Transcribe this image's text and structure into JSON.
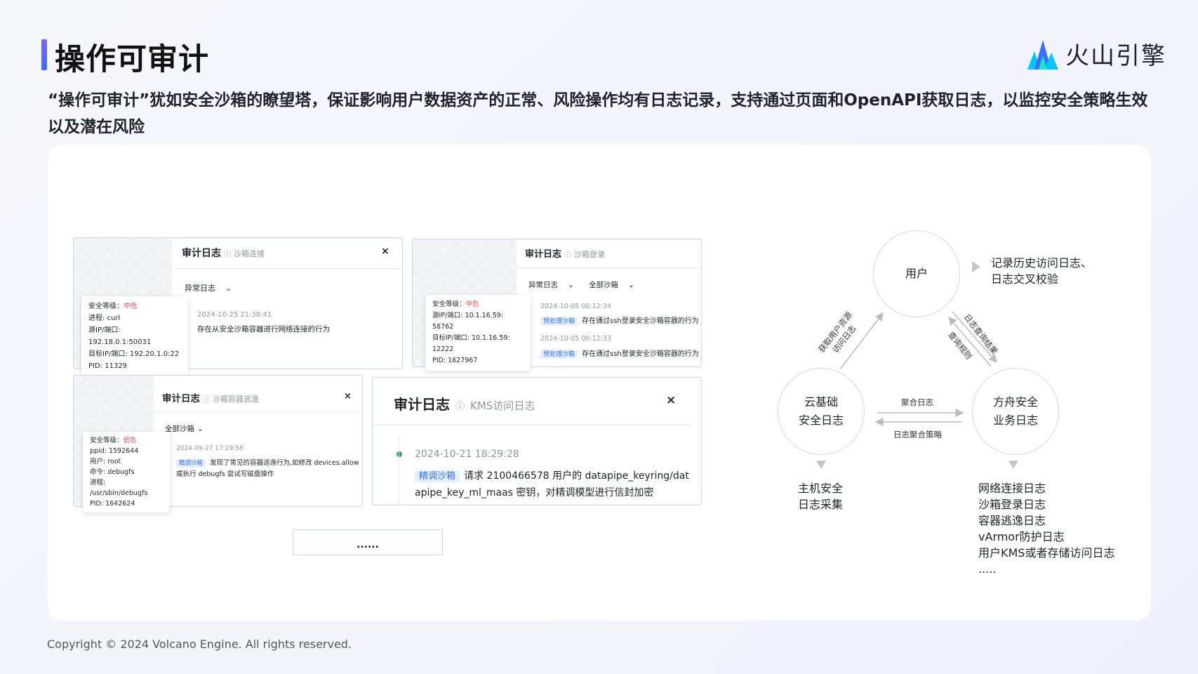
{
  "header": {
    "title": "操作可审计",
    "logo_text": "火山引擎",
    "subtitle": "“操作可审计”犹如安全沙箱的瞭望塔，保证影响用户数据资产的正常、风险操作均有日志记录，支持通过页面和OpenAPI获取日志，以监控安全策略生效以及潜在风险"
  },
  "cards": [
    {
      "title": "审计日志",
      "subtitle": "沙箱连接",
      "close": "×",
      "filters": [
        "异常日志"
      ],
      "tooltip": {
        "level_label": "安全等级：",
        "level": "中危",
        "lines": [
          "进程: curl",
          "源IP/端口: 192.18.0.1:50031",
          "目标IP/端口: 192.20.1.0:22",
          "PID: 11329"
        ]
      },
      "entries": [
        {
          "time": "2024-10-25 21:38:41",
          "tag": "",
          "text": "存在从安全沙箱容器进行网络连接的行为"
        }
      ]
    },
    {
      "title": "审计日志",
      "subtitle": "沙箱登录",
      "close": "",
      "filters": [
        "异常日志",
        "全部沙箱"
      ],
      "tooltip": {
        "level_label": "安全等级：",
        "level": "中危",
        "lines": [
          "源IP/端口: 10.1.16.59: 58762",
          "目标IP/端口: 10.1.16.59: 12222",
          "PID: 1627967"
        ]
      },
      "entries": [
        {
          "time": "2024-10-05 00:12:34",
          "tag": "预处理沙箱",
          "text": "存在通过ssh登录安全沙箱容器的行为"
        },
        {
          "time": "2024-10-05 00:12:33",
          "tag": "预处理沙箱",
          "text": "存在通过ssh登录安全沙箱容器的行为"
        }
      ]
    },
    {
      "title": "审计日志",
      "subtitle": "沙箱容器逃逸",
      "close": "×",
      "filters": [
        "全部沙箱"
      ],
      "tooltip": {
        "level_label": "安全等级：",
        "level": "低危",
        "lines": [
          "ppid: 1592644",
          "用户: root",
          "命令: debugfs",
          "进程: /usr/sbin/debugfs",
          "PID: 1642624"
        ]
      },
      "entries": [
        {
          "time": "2024-09-27 17:19:58",
          "tag": "精调沙箱",
          "text": "发现了常见的容器逃逸行为,如修改 devices.allow",
          "text2": "或执行 debugfs 尝试写磁盘操作"
        }
      ]
    },
    {
      "title": "审计日志",
      "subtitle": "KMS访问日志",
      "close": "×",
      "entries": [
        {
          "time": "2024-10-21 18:29:28",
          "tag": "精调沙箱",
          "text": "请求 2100466578 用户的 datapipe_keyring/dat",
          "text2": "apipe_key_ml_maas 密钥，对精调模型进行信封加密"
        }
      ]
    }
  ],
  "more_box": "......",
  "diagram": {
    "nodes": {
      "user": "用户",
      "cloud": [
        "云基础",
        "安全日志"
      ],
      "ark": [
        "方舟安全",
        "业务日志"
      ]
    },
    "user_note": [
      "记录历史访问日志、",
      "日志交叉校验"
    ],
    "cloud_note": [
      "主机安全",
      "日志采集"
    ],
    "ark_note": [
      "网络连接日志",
      "沙箱登录日志",
      "容器逃逸日志",
      "vArmor防护日志",
      "用户KMS或者存储访问日志",
      "....."
    ],
    "edges": {
      "cloud_to_user": [
        "获取用户资源",
        "访问日志"
      ],
      "user_to_ark": "日志查询结果",
      "ark_to_user": "查询规则",
      "cloud_to_ark": "聚合日志",
      "ark_to_cloud": "日志聚合策略"
    }
  },
  "footer": "Copyright © 2024 Volcano Engine. All rights reserved.",
  "colors": {
    "accent": "#3d6dff",
    "danger": "#f54a45",
    "tag_bg": "#e6efff",
    "dot": "#2ba471"
  }
}
